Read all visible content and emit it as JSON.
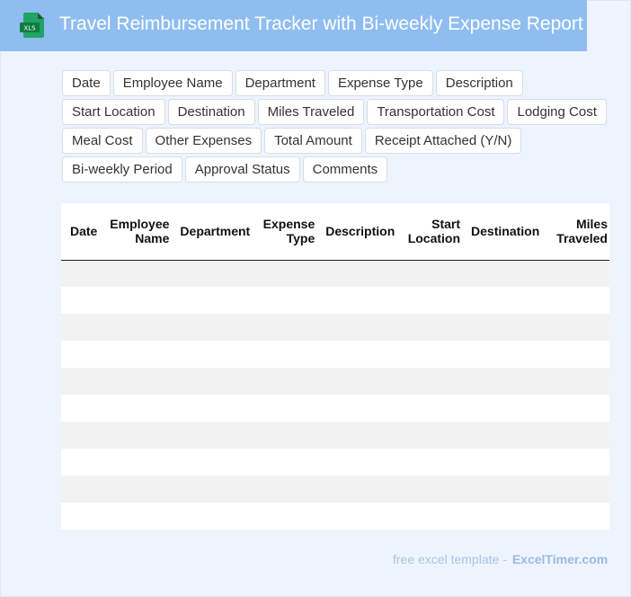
{
  "header": {
    "title": "Travel Reimbursement Tracker with Bi-weekly Expense Report",
    "icon_label": "XLS",
    "icon_color": "#1e7145",
    "bar_color": "#8fbdf0"
  },
  "fields": [
    "Date",
    "Employee Name",
    "Department",
    "Expense Type",
    "Description",
    "Start Location",
    "Destination",
    "Miles Traveled",
    "Transportation Cost",
    "Lodging Cost",
    "Meal Cost",
    "Other Expenses",
    "Total Amount",
    "Receipt Attached (Y/N)",
    "Bi-weekly Period",
    "Approval Status",
    "Comments"
  ],
  "table": {
    "columns": [
      {
        "label": "Date",
        "align": "left"
      },
      {
        "label": "Employee Name",
        "align": "right"
      },
      {
        "label": "Department",
        "align": "left"
      },
      {
        "label": "Expense Type",
        "align": "right"
      },
      {
        "label": "Description",
        "align": "left"
      },
      {
        "label": "Start Location",
        "align": "right"
      },
      {
        "label": "Destination",
        "align": "left"
      },
      {
        "label": "Miles Traveled",
        "align": "right"
      }
    ],
    "rows": [
      [
        "",
        "",
        "",
        "",
        "",
        "",
        "",
        ""
      ],
      [
        "",
        "",
        "",
        "",
        "",
        "",
        "",
        ""
      ],
      [
        "",
        "",
        "",
        "",
        "",
        "",
        "",
        ""
      ],
      [
        "",
        "",
        "",
        "",
        "",
        "",
        "",
        ""
      ],
      [
        "",
        "",
        "",
        "",
        "",
        "",
        "",
        ""
      ],
      [
        "",
        "",
        "",
        "",
        "",
        "",
        "",
        ""
      ],
      [
        "",
        "",
        "",
        "",
        "",
        "",
        "",
        ""
      ],
      [
        "",
        "",
        "",
        "",
        "",
        "",
        "",
        ""
      ],
      [
        "",
        "",
        "",
        "",
        "",
        "",
        "",
        ""
      ],
      [
        "",
        "",
        "",
        "",
        "",
        "",
        "",
        ""
      ]
    ]
  },
  "footer": {
    "text": "free excel template -",
    "brand": "ExcelTimer.com"
  }
}
